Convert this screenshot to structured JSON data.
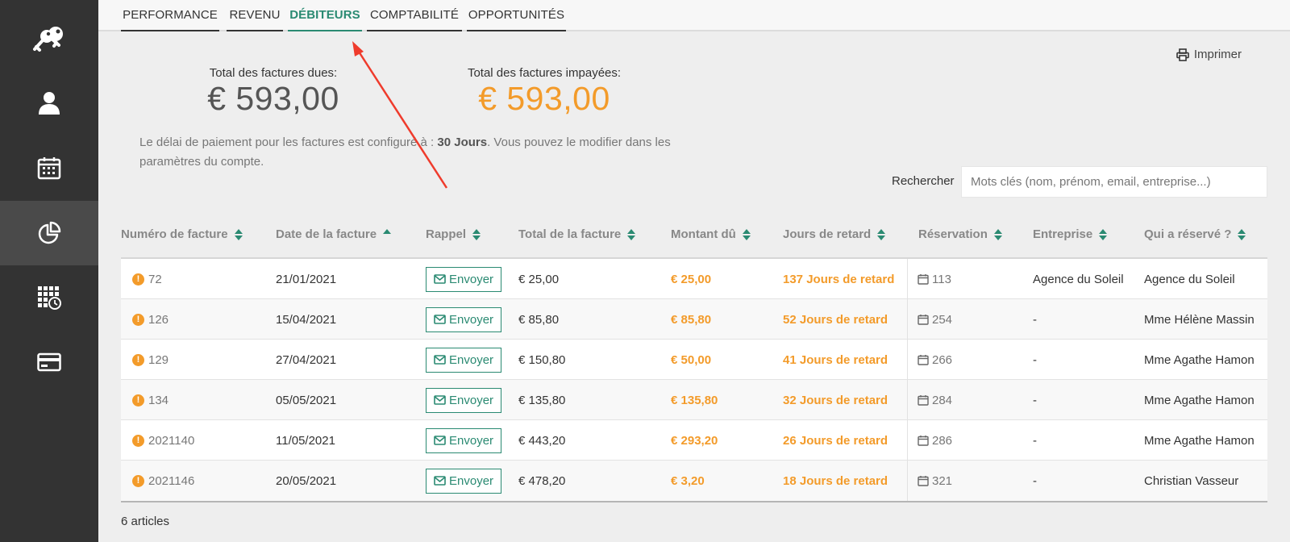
{
  "sidebar": {
    "items": [
      {
        "icon": "keys-icon",
        "active": false
      },
      {
        "icon": "user-icon",
        "active": false
      },
      {
        "icon": "calendar-icon",
        "active": false
      },
      {
        "icon": "pie-chart-icon",
        "active": true
      },
      {
        "icon": "grid-clock-icon",
        "active": false
      },
      {
        "icon": "credit-card-icon",
        "active": false
      }
    ]
  },
  "tabs": [
    {
      "label": "PERFORMANCE",
      "active": false
    },
    {
      "label": "REVENU",
      "active": false
    },
    {
      "label": "DÉBITEURS",
      "active": true
    },
    {
      "label": "COMPTABILITÉ",
      "active": false
    },
    {
      "label": "OPPORTUNITÉS",
      "active": false
    }
  ],
  "print_label": "Imprimer",
  "totals": {
    "due_label": "Total des factures dues:",
    "due_value": "€ 593,00",
    "unpaid_label": "Total des factures impayées:",
    "unpaid_value": "€ 593,00"
  },
  "notice": {
    "before": "Le délai de paiement pour les factures est configuré à : ",
    "bold": "30 Jours",
    "after": ". Vous pouvez le modifier dans les paramètres du compte."
  },
  "search": {
    "label": "Rechercher",
    "placeholder": "Mots clés (nom, prénom, email, entreprise...)",
    "value": ""
  },
  "table": {
    "headers": [
      "Numéro de facture",
      "Date de la facture",
      "Rappel",
      "Total de la facture",
      "Montant dû",
      "Jours de retard",
      "Réservation",
      "Entreprise",
      "Qui a réservé ?"
    ],
    "send_label": "Envoyer",
    "rows": [
      {
        "invoice": "72",
        "date": "21/01/2021",
        "total": "€ 25,00",
        "due": "€ 25,00",
        "late": "137 Jours de retard",
        "reservation": "113",
        "company": "Agence du Soleil",
        "booked_by": "Agence du Soleil"
      },
      {
        "invoice": "126",
        "date": "15/04/2021",
        "total": "€ 85,80",
        "due": "€ 85,80",
        "late": "52 Jours de retard",
        "reservation": "254",
        "company": "-",
        "booked_by": "Mme Hélène Massin"
      },
      {
        "invoice": "129",
        "date": "27/04/2021",
        "total": "€ 150,80",
        "due": "€ 50,00",
        "late": "41 Jours de retard",
        "reservation": "266",
        "company": "-",
        "booked_by": "Mme Agathe Hamon"
      },
      {
        "invoice": "134",
        "date": "05/05/2021",
        "total": "€ 135,80",
        "due": "€ 135,80",
        "late": "32 Jours de retard",
        "reservation": "284",
        "company": "-",
        "booked_by": "Mme Agathe Hamon"
      },
      {
        "invoice": "2021140",
        "date": "11/05/2021",
        "total": "€ 443,20",
        "due": "€ 293,20",
        "late": "26 Jours de retard",
        "reservation": "286",
        "company": "-",
        "booked_by": "Mme Agathe Hamon"
      },
      {
        "invoice": "2021146",
        "date": "20/05/2021",
        "total": "€ 478,20",
        "due": "€ 3,20",
        "late": "18 Jours de retard",
        "reservation": "321",
        "company": "-",
        "booked_by": "Christian Vasseur"
      }
    ]
  },
  "item_count": "6 articles",
  "colors": {
    "accent": "#2a8a72",
    "warning": "#f39b2a",
    "sidebar": "#333333",
    "annotation_arrow": "#ef3b2c"
  }
}
